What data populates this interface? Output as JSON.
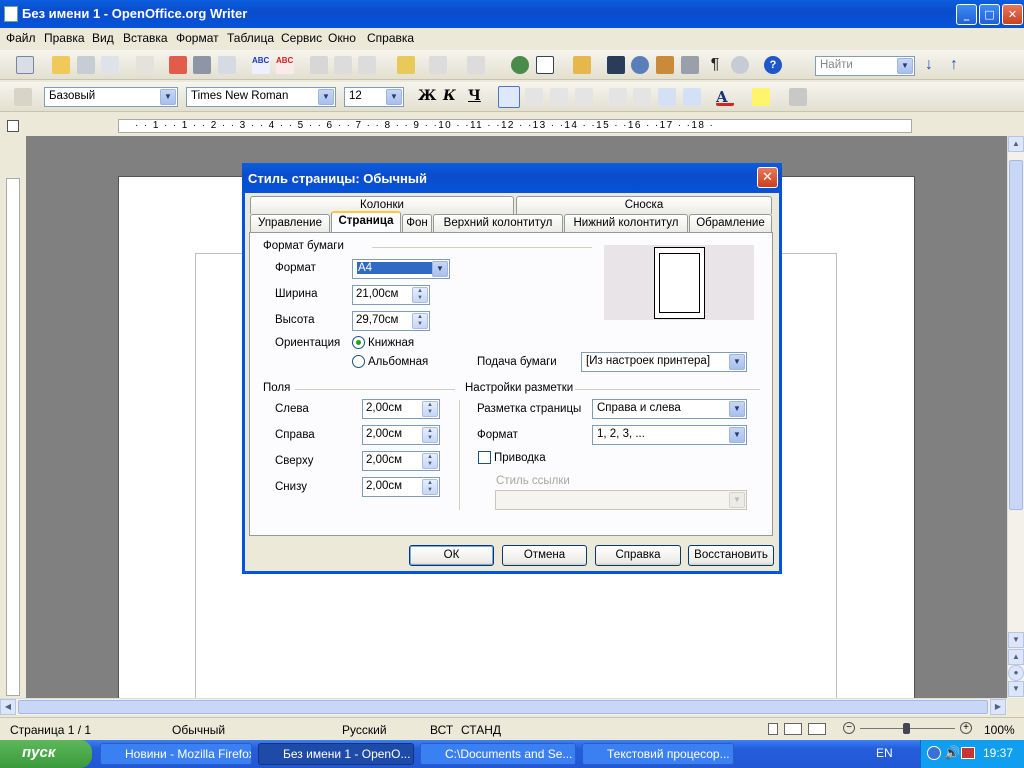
{
  "window": {
    "title": "Без имени 1 - OpenOffice.org Writer",
    "minimize": "_",
    "maximize": "□",
    "close": "✕"
  },
  "menu": [
    "Файл",
    "Правка",
    "Вид",
    "Вставка",
    "Формат",
    "Таблица",
    "Сервис",
    "Окно",
    "Справка"
  ],
  "toolbar": {
    "search_placeholder": "Найти"
  },
  "format_bar": {
    "style": "Базовый",
    "font": "Times New Roman",
    "size": "12",
    "bold": "Ж",
    "italic": "К",
    "underline": "Ч"
  },
  "ruler": {
    "marks": "· · 1 · · 1 · · 2 · · 3 · · 4 · · 5 · · 6 · · 7 · · 8 · · 9 · ·10 · ·11 · ·12 · ·13 · ·14 · ·15 · ·16 · ·17 · ·18 ·"
  },
  "dialog": {
    "title": "Стиль страницы: Обычный",
    "tabs_top": [
      "Колонки",
      "Сноска"
    ],
    "tabs": [
      "Управление",
      "Страница",
      "Фон",
      "Верхний колонтитул",
      "Нижний колонтитул",
      "Обрамление"
    ],
    "paper_format": {
      "section": "Формат бумаги",
      "format_label": "Формат",
      "format_value": "A4",
      "width_label": "Ширина",
      "width_value": "21,00см",
      "height_label": "Высота",
      "height_value": "29,70см",
      "orientation_label": "Ориентация",
      "portrait": "Книжная",
      "landscape": "Альбомная",
      "tray_label": "Подача бумаги",
      "tray_value": "[Из настроек принтера]"
    },
    "margins": {
      "section": "Поля",
      "left_label": "Слева",
      "left_value": "2,00см",
      "right_label": "Справа",
      "right_value": "2,00см",
      "top_label": "Сверху",
      "top_value": "2,00см",
      "bottom_label": "Снизу",
      "bottom_value": "2,00см"
    },
    "layout": {
      "section": "Настройки разметки",
      "page_layout_label": "Разметка страницы",
      "page_layout_value": "Справа и слева",
      "format_label": "Формат",
      "format_value": "1, 2, 3, ...",
      "register_label": "Приводка",
      "ref_style_label": "Стиль ссылки",
      "ref_style_value": ""
    },
    "buttons": {
      "ok": "ОК",
      "cancel": "Отмена",
      "help": "Справка",
      "reset": "Восстановить"
    }
  },
  "status": {
    "page": "Страница  1 / 1",
    "style": "Обычный",
    "language": "Русский",
    "insert": "ВСТ",
    "mode": "СТАНД",
    "zoom": "100%"
  },
  "taskbar": {
    "start": "пуск",
    "tasks": [
      "Новини - Mozilla Firefox",
      "Без имени 1 - OpenO...",
      "C:\\Documents and Se...",
      "Текстовий процесор..."
    ],
    "lang": "EN",
    "clock": "19:37"
  },
  "colors": {
    "title_blue": "#0a4ccc",
    "accent_tab": "#ffc83c",
    "start_green": "#3a9a3a"
  }
}
